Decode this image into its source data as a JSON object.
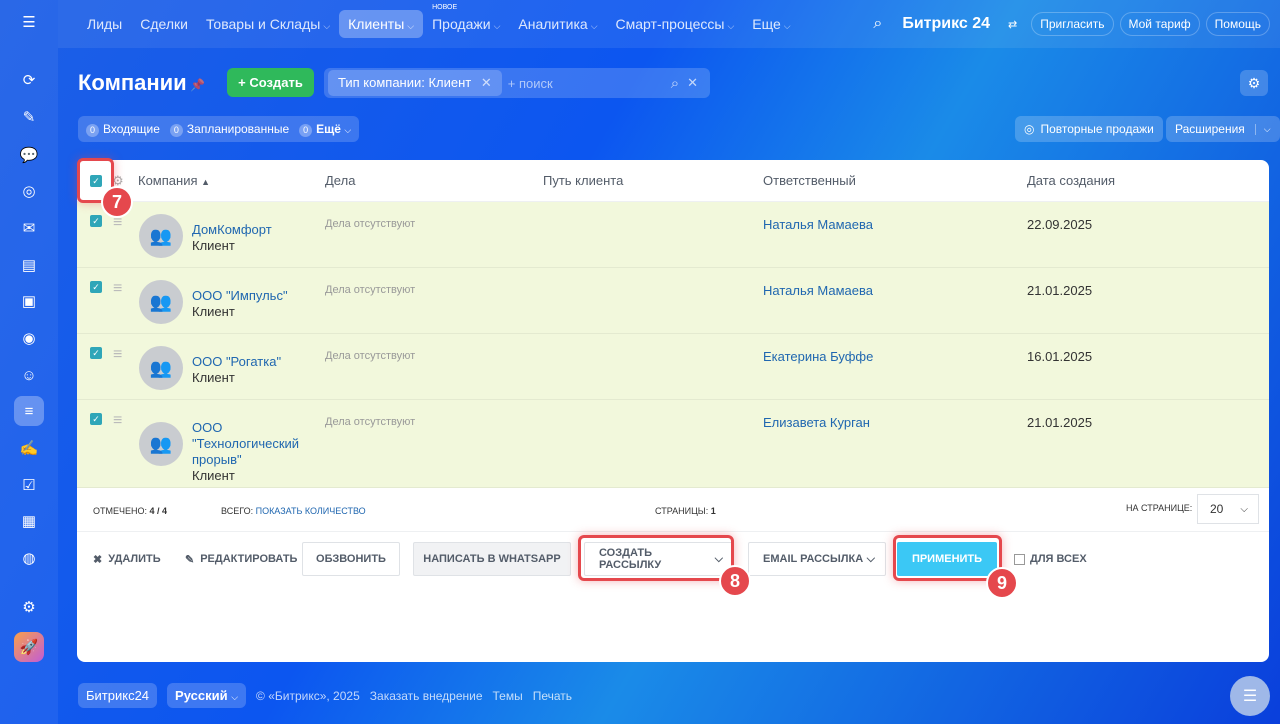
{
  "topnav": {
    "items": [
      {
        "label": "Лиды",
        "dropdown": false
      },
      {
        "label": "Сделки",
        "dropdown": false
      },
      {
        "label": "Товары и Склады",
        "dropdown": true
      },
      {
        "label": "Клиенты",
        "dropdown": true,
        "active": true
      },
      {
        "label": "Продажи",
        "dropdown": true,
        "badge": "НОВОЕ"
      },
      {
        "label": "Аналитика",
        "dropdown": true
      },
      {
        "label": "Смарт-процессы",
        "dropdown": true
      },
      {
        "label": "Еще",
        "dropdown": true
      }
    ],
    "logo": "Битрикс 24",
    "invite": "Пригласить",
    "tariff": "Мой тариф",
    "help": "Помощь"
  },
  "page": {
    "title": "Компании",
    "create_label": "+ Создать",
    "filter_tag": "Тип компании: Клиент",
    "search_placeholder": "+ поиск"
  },
  "counters": [
    {
      "count": "0",
      "label": "Входящие"
    },
    {
      "count": "0",
      "label": "Запланированные"
    },
    {
      "count": "0",
      "label": "Ещё"
    }
  ],
  "repeat_sales": "Повторные продажи",
  "extensions": "Расширения",
  "table": {
    "columns": [
      "Компания",
      "Дела",
      "Путь клиента",
      "Ответственный",
      "Дата создания"
    ],
    "rows": [
      {
        "name": "ДомКомфорт",
        "type": "Клиент",
        "deals": "Дела отсутствуют",
        "responsible": "Наталья Мамаева",
        "date": "22.09.2025",
        "checked": true
      },
      {
        "name": "ООО \"Импульс\"",
        "type": "Клиент",
        "deals": "Дела отсутствуют",
        "responsible": "Наталья Мамаева",
        "date": "21.01.2025",
        "checked": true
      },
      {
        "name": "ООО \"Рогатка\"",
        "type": "Клиент",
        "deals": "Дела отсутствуют",
        "responsible": "Екатерина Буффе",
        "date": "16.01.2025",
        "checked": true
      },
      {
        "name": "ООО \"Технологический прорыв\"",
        "type": "Клиент",
        "deals": "Дела отсутствуют",
        "responsible": "Елизавета Курган",
        "date": "21.01.2025",
        "checked": true
      }
    ]
  },
  "stats": {
    "marked_label": "Отмечено:",
    "marked": "4 / 4",
    "total_label": "Всего:",
    "total_link": "Показать количество",
    "pages_label": "Страницы:",
    "pages": "1",
    "per_page_label": "На странице:",
    "per_page": "20"
  },
  "actions": {
    "delete": "Удалить",
    "edit": "Редактировать",
    "call": "Обзвонить",
    "whatsapp": "Написать в WhatsApp",
    "mailing": "Создать рассылку",
    "email": "Email рассылка",
    "apply": "Применить",
    "for_all": "Для всех"
  },
  "annotations": [
    "7",
    "8",
    "9"
  ],
  "footer": {
    "brand": "Битрикс24",
    "language": "Русский",
    "copyright": "© «Битрикс», 2025",
    "order": "Заказать внедрение",
    "themes": "Темы",
    "print": "Печать"
  },
  "colors": {
    "accent_green": "#2fb95b",
    "apply": "#3bc8f5",
    "highlight": "#e5484d",
    "selected_row": "#f2f8dc"
  }
}
